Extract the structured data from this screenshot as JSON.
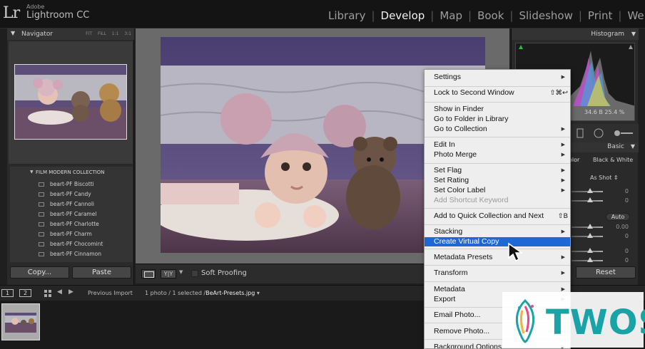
{
  "app": {
    "logo": "Lr",
    "vendor": "Adobe",
    "name": "Lightroom CC"
  },
  "modules": [
    "Library",
    "Develop",
    "Map",
    "Book",
    "Slideshow",
    "Print",
    "Web"
  ],
  "active_module": "Develop",
  "navigator": {
    "title": "Navigator",
    "zoom_options": [
      "FIT",
      "FILL",
      "1:1",
      "3:1"
    ]
  },
  "presets": {
    "collection": "FILM MODERN COLLECTION",
    "items": [
      "beart-PF Biscotti",
      "beart-PF Candy",
      "beart-PF Cannoli",
      "beart-PF Caramel",
      "beart-PF Charlotte",
      "beart-PF Charm",
      "beart-PF Chocomint",
      "beart-PF Cinnamon"
    ]
  },
  "left_buttons": {
    "copy": "Copy...",
    "paste": "Paste"
  },
  "toolbar": {
    "view_mode": "Y|Y",
    "soft_proofing": "Soft Proofing"
  },
  "histogram": {
    "title": "Histogram",
    "readout": "34.6  B  25.4 %"
  },
  "basic": {
    "title": "Basic",
    "tab_color": "olor",
    "tab_bw": "Black & White",
    "wb": "As Shot",
    "slider_values": [
      "0",
      "0",
      "0.00",
      "0",
      "0",
      "0",
      "0"
    ],
    "auto": "Auto"
  },
  "right_buttons": {
    "reset": "Reset"
  },
  "filmstrip_bar": {
    "screen1": "1",
    "screen2": "2",
    "source": "Previous Import",
    "count": "1 photo / 1 selected /",
    "filename": "BeArt-Presets.jpg"
  },
  "context_menu": {
    "items": [
      {
        "label": "Settings",
        "submenu": true
      },
      {
        "label": "Lock to Second Window",
        "shortcut": "⇧⌘↩"
      },
      {
        "label": "Show in Finder"
      },
      {
        "label": "Go to Folder in Library"
      },
      {
        "label": "Go to Collection",
        "submenu": true
      },
      {
        "label": "Edit In",
        "submenu": true
      },
      {
        "label": "Photo Merge",
        "submenu": true
      },
      {
        "label": "Set Flag",
        "submenu": true
      },
      {
        "label": "Set Rating",
        "submenu": true
      },
      {
        "label": "Set Color Label",
        "submenu": true
      },
      {
        "label": "Add Shortcut Keyword",
        "disabled": true
      },
      {
        "label": "Add to Quick Collection and Next",
        "shortcut": "⇧B"
      },
      {
        "label": "Stacking",
        "submenu": true
      },
      {
        "label": "Create Virtual Copy",
        "highlighted": true
      },
      {
        "label": "Metadata Presets",
        "submenu": true
      },
      {
        "label": "Transform",
        "submenu": true
      },
      {
        "label": "Metadata",
        "submenu": true
      },
      {
        "label": "Export",
        "submenu": true
      },
      {
        "label": "Email Photo..."
      },
      {
        "label": "Remove Photo..."
      },
      {
        "label": "Background Options",
        "submenu": true
      }
    ]
  },
  "watermark": {
    "text": "TWOS"
  },
  "colors": {
    "menu_highlight": "#1d68d6",
    "watermark": "#1aa3a6",
    "panel": "#2a2a2a"
  }
}
